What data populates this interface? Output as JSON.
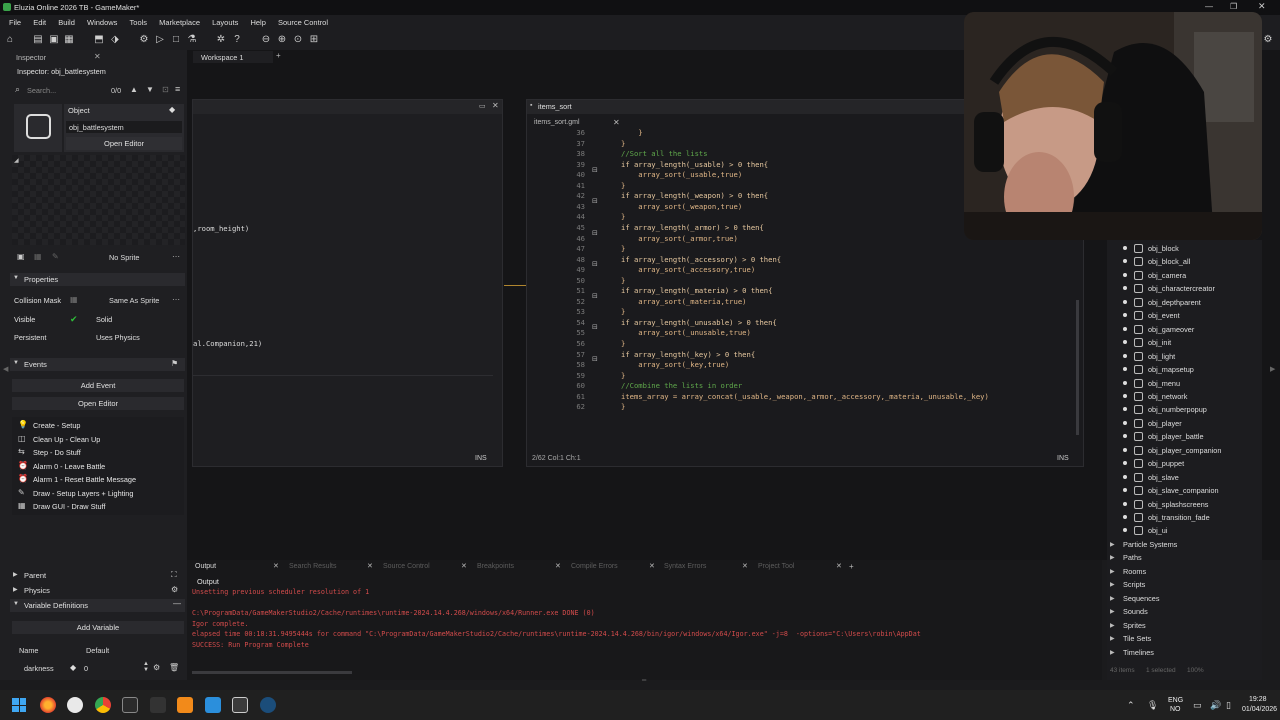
{
  "window": {
    "title": "Eluzia Online 2026 TB - GameMaker*"
  },
  "menu": [
    "File",
    "Edit",
    "Build",
    "Windows",
    "Tools",
    "Marketplace",
    "Layouts",
    "Help",
    "Source Control"
  ],
  "workspace_tab": "Workspace 1",
  "inspector": {
    "tab_label": "Inspector",
    "header": "Inspector: obj_battlesystem",
    "search_placeholder": "Search...",
    "search_count": "0/0",
    "object_label": "Object",
    "object_name": "obj_battlesystem",
    "open_editor": "Open Editor",
    "sprite": "No Sprite",
    "properties_label": "Properties",
    "collision_mask_label": "Collision Mask",
    "collision_mask_value": "Same As Sprite",
    "visible_label": "Visible",
    "solid_label": "Solid",
    "persistent_label": "Persistent",
    "uses_physics_label": "Uses Physics",
    "events_label": "Events",
    "add_event": "Add Event",
    "open_editor_2": "Open Editor",
    "events": [
      "Create - Setup",
      "Clean Up - Clean Up",
      "Step - Do Stuff",
      "Alarm 0 - Leave Battle",
      "Alarm 1 - Reset Battle Message",
      "Draw - Setup Layers + Lighting",
      "Draw GUI - Draw Stuff"
    ],
    "parent_label": "Parent",
    "physics_label": "Physics",
    "variable_definitions_label": "Variable Definitions",
    "add_variable": "Add Variable",
    "var_name_header": "Name",
    "var_default_header": "Default",
    "var_name": "darkness",
    "var_value": "0"
  },
  "left_editor": {
    "line1": ",room_height)",
    "line2": "al.Companion,21)",
    "status_mode": "INS"
  },
  "code_editor": {
    "window_title": "items_sort",
    "file_tab": "items_sort.gml",
    "status_position": "2/62 Col:1 Ch:1",
    "status_mode": "INS",
    "lines": [
      {
        "n": "36",
        "t": "    }"
      },
      {
        "n": "37",
        "t": "}"
      },
      {
        "n": "38",
        "t": "//Sort all the lists"
      },
      {
        "n": "39",
        "t": "if array_length(_usable) > 0 then{"
      },
      {
        "n": "40",
        "t": "    array_sort(_usable,true)"
      },
      {
        "n": "41",
        "t": "}"
      },
      {
        "n": "42",
        "t": "if array_length(_weapon) > 0 then{"
      },
      {
        "n": "43",
        "t": "    array_sort(_weapon,true)"
      },
      {
        "n": "44",
        "t": "}"
      },
      {
        "n": "45",
        "t": "if array_length(_armor) > 0 then{"
      },
      {
        "n": "46",
        "t": "    array_sort(_armor,true)"
      },
      {
        "n": "47",
        "t": "}"
      },
      {
        "n": "48",
        "t": "if array_length(_accessory) > 0 then{"
      },
      {
        "n": "49",
        "t": "    array_sort(_accessory,true)"
      },
      {
        "n": "50",
        "t": "}"
      },
      {
        "n": "51",
        "t": "if array_length(_materia) > 0 then{"
      },
      {
        "n": "52",
        "t": "    array_sort(_materia,true)"
      },
      {
        "n": "53",
        "t": "}"
      },
      {
        "n": "54",
        "t": "if array_length(_unusable) > 0 then{"
      },
      {
        "n": "55",
        "t": "    array_sort(_unusable,true)"
      },
      {
        "n": "56",
        "t": "}"
      },
      {
        "n": "57",
        "t": "if array_length(_key) > 0 then{"
      },
      {
        "n": "58",
        "t": "    array_sort(_key,true)"
      },
      {
        "n": "59",
        "t": "}"
      },
      {
        "n": "60",
        "t": "//Combine the lists in order"
      },
      {
        "n": "61",
        "t": "items_array = array_concat(_usable,_weapon,_armor,_accessory,_materia,_unusable,_key)"
      },
      {
        "n": "62",
        "t": "}"
      }
    ]
  },
  "asset_browser": {
    "objects": [
      "obj_block",
      "obj_block_all",
      "obj_camera",
      "obj_charactercreator",
      "obj_depthparent",
      "obj_event",
      "obj_gameover",
      "obj_init",
      "obj_light",
      "obj_mapsetup",
      "obj_menu",
      "obj_network",
      "obj_numberpopup",
      "obj_player",
      "obj_player_battle",
      "obj_player_companion",
      "obj_puppet",
      "obj_slave",
      "obj_slave_companion",
      "obj_splashscreens",
      "obj_transition_fade",
      "obj_ui"
    ],
    "groups": [
      "Particle Systems",
      "Paths",
      "Rooms",
      "Scripts",
      "Sequences",
      "Sounds",
      "Sprites",
      "Tile Sets",
      "Timelines"
    ],
    "footer_items": "43 items",
    "footer_selected": "1 selected",
    "footer_zoom": "100%"
  },
  "output": {
    "tabs": [
      "Output",
      "Search Results",
      "Source Control",
      "Breakpoints",
      "Compile Errors",
      "Syntax Errors",
      "Project Tool"
    ],
    "sub_tab": "Output",
    "lines": [
      "Unsetting previous scheduler resolution of 1",
      "",
      "C:\\ProgramData/GameMakerStudio2/Cache/runtimes\\runtime-2024.14.4.268/windows/x64/Runner.exe DONE (0)",
      "Igor complete.",
      "elapsed time 00:18:31.9495444s for command \"C:\\ProgramData/GameMakerStudio2/Cache/runtimes\\runtime-2024.14.4.268/bin/igor/windows/x64/Igor.exe\" -j=8  -options=\"C:\\Users\\robin\\AppDat",
      "SUCCESS: Run Program Complete"
    ]
  },
  "taskbar": {
    "lang_top": "ENG",
    "lang_bottom": "NO",
    "time": "19:28",
    "date": "01/04/2026"
  },
  "colors": {
    "background": "#151517",
    "keyword": "#d7a86e",
    "comment": "#5fa84b",
    "output_text": "#d24b4b",
    "accent_green": "#2fbf3a"
  }
}
